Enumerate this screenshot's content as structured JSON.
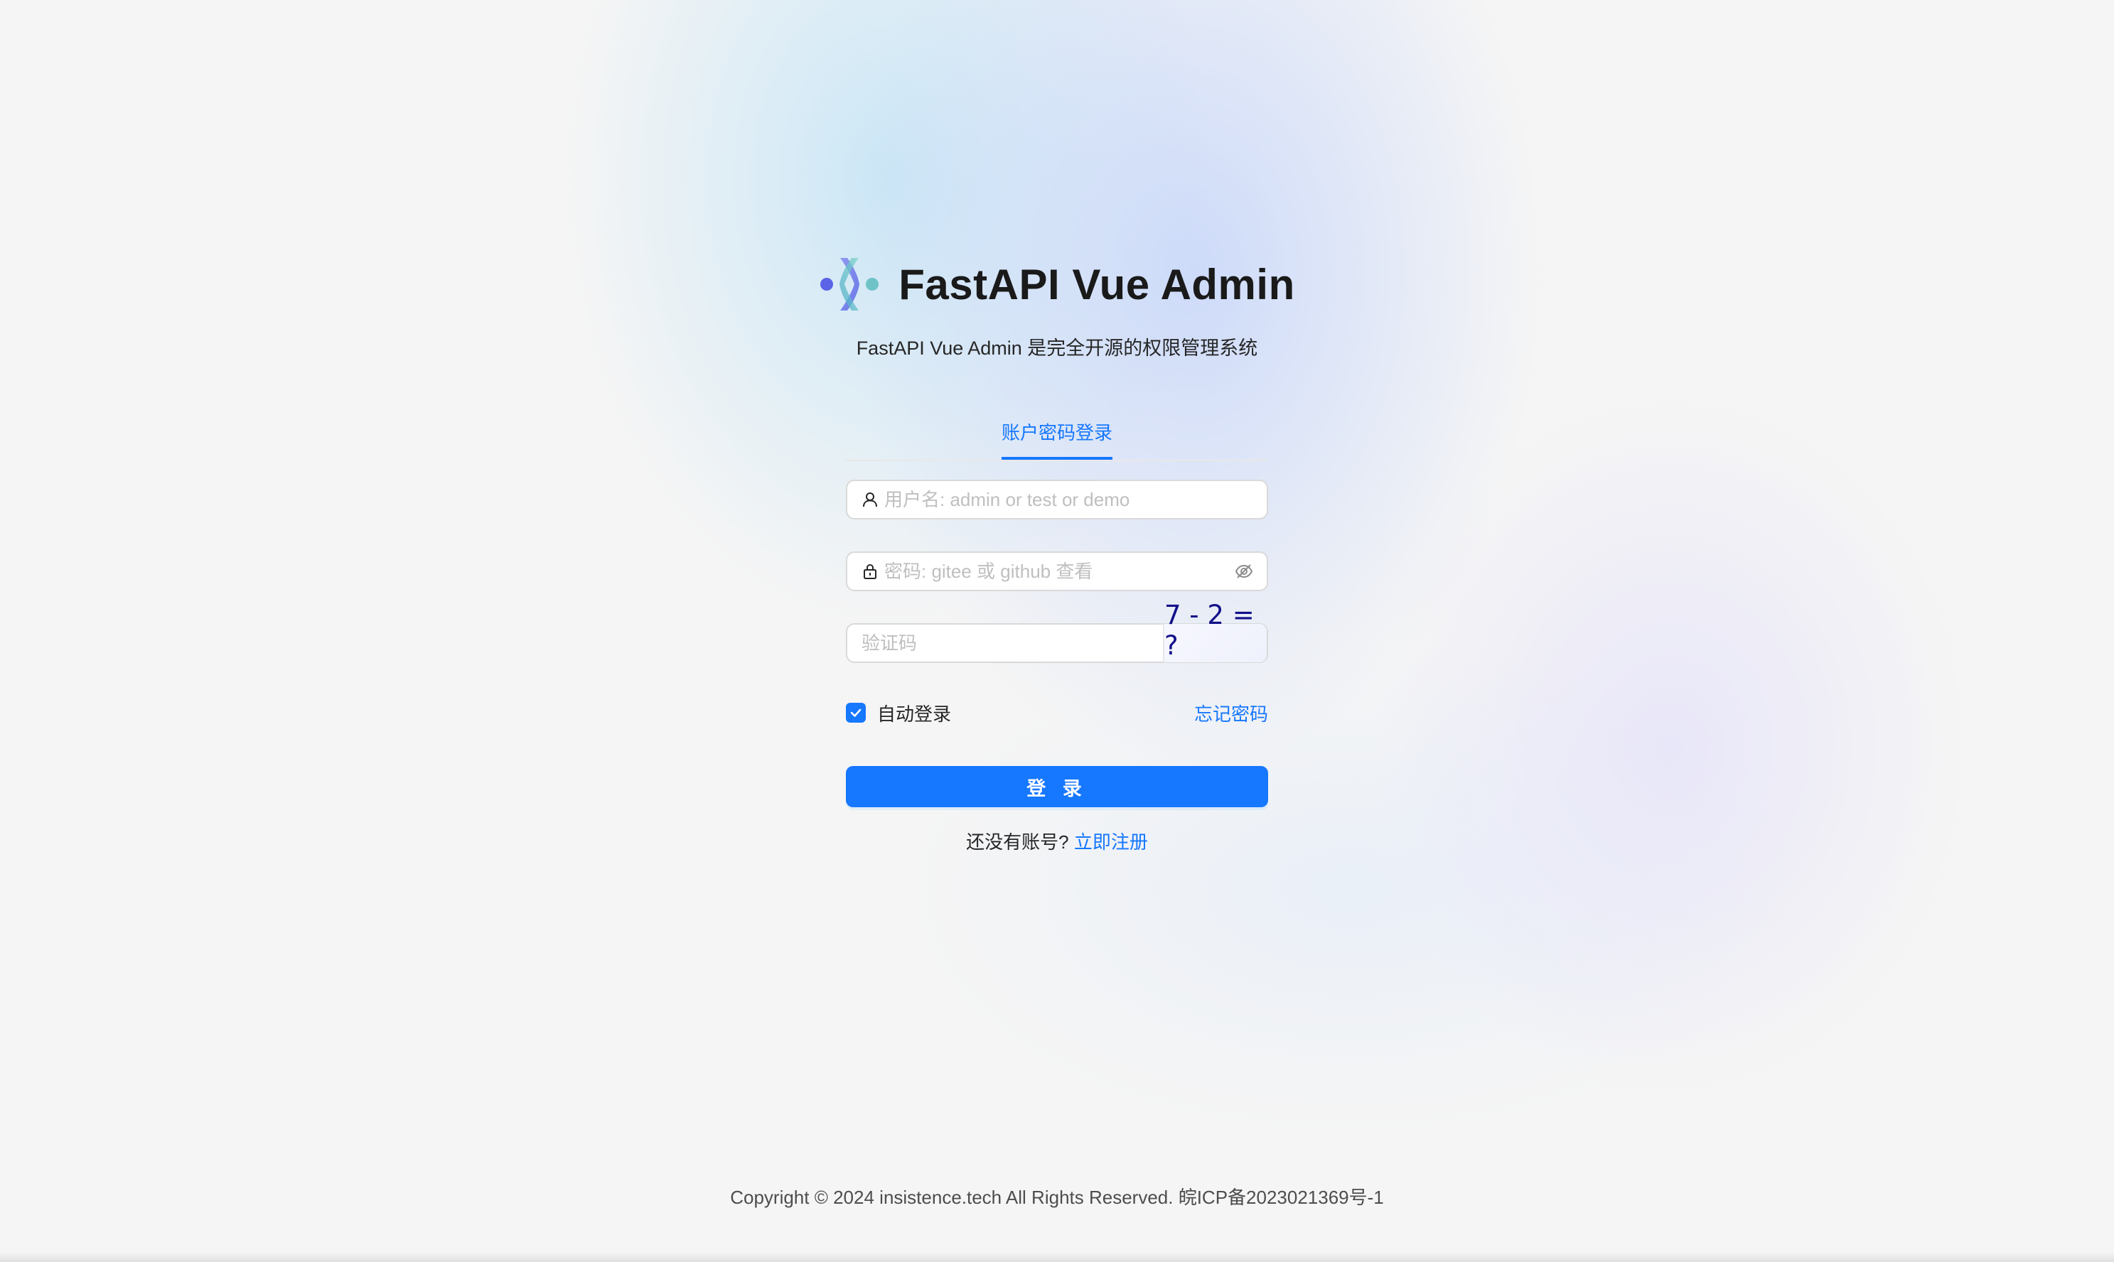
{
  "app": {
    "title": "FastAPI Vue Admin",
    "subtitle": "FastAPI Vue Admin 是完全开源的权限管理系统",
    "logo_icon": "fastapi-vue-admin-logo"
  },
  "login_tabs": [
    {
      "label": "账户密码登录",
      "active": true
    }
  ],
  "form": {
    "username": {
      "value": "",
      "placeholder": "用户名: admin or test or demo",
      "icon": "user-icon"
    },
    "password": {
      "value": "",
      "placeholder": "密码: gitee 或 github 查看",
      "icon": "lock-icon",
      "toggle_icon": "eye-invisible-icon"
    },
    "captcha": {
      "value": "",
      "placeholder": "验证码",
      "image_text": "7 - 2 = ?"
    },
    "auto_login": {
      "label": "自动登录",
      "checked": true
    },
    "forgot_password": "忘记密码",
    "submit_label": "登 录",
    "register_prompt": "还没有账号?",
    "register_link": "立即注册"
  },
  "footer": {
    "copyright": "Copyright © 2024 insistence.tech All Rights Reserved. 皖ICP备2023021369号-1"
  },
  "colors": {
    "primary": "#1677ff",
    "background": "#f5f5f5",
    "text": "#262626",
    "placeholder": "#bfbfbf"
  }
}
